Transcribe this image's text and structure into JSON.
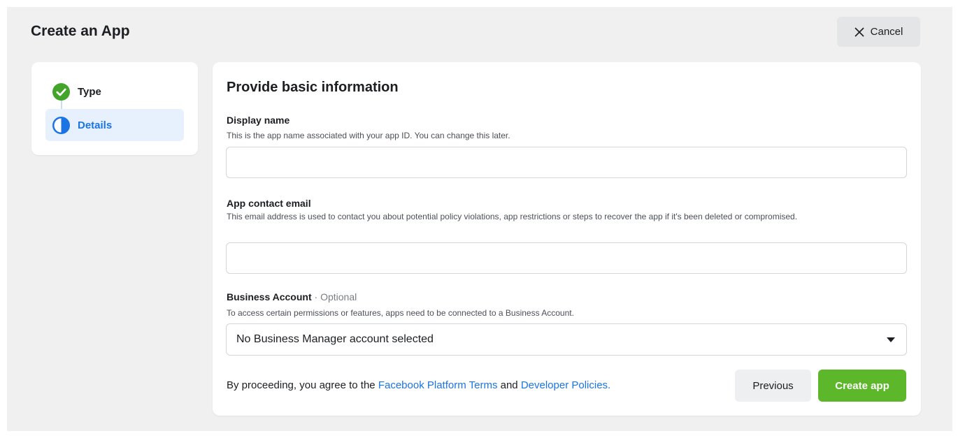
{
  "header": {
    "title": "Create an App",
    "cancel_label": "Cancel",
    "cancel_icon": "close-icon"
  },
  "steps": [
    {
      "label": "Type",
      "status": "complete",
      "icon": "check-circle-icon",
      "color": "#42a52a"
    },
    {
      "label": "Details",
      "status": "current",
      "icon": "half-circle-icon",
      "color": "#1b74e4"
    }
  ],
  "form": {
    "title": "Provide basic information",
    "display_name": {
      "label": "Display name",
      "help": "This is the app name associated with your app ID. You can change this later.",
      "value": ""
    },
    "contact_email": {
      "label": "App contact email",
      "help": "This email address is used to contact you about potential policy violations, app restrictions or steps to recover the app if it's been deleted or compromised.",
      "value": ""
    },
    "business_account": {
      "label": "Business Account",
      "optional": "· Optional",
      "help": "To access certain permissions or features, apps need to be connected to a Business Account.",
      "selected": "No Business Manager account selected"
    },
    "terms": {
      "prefix": "By proceeding, you agree to the",
      "link1": "Facebook Platform Terms",
      "conjunction": "and",
      "link2": "Developer Policies."
    },
    "previous_label": "Previous",
    "create_label": "Create app"
  },
  "colors": {
    "accent": "#1b74e4",
    "success": "#5cb82a",
    "background": "#f0f0f1"
  }
}
